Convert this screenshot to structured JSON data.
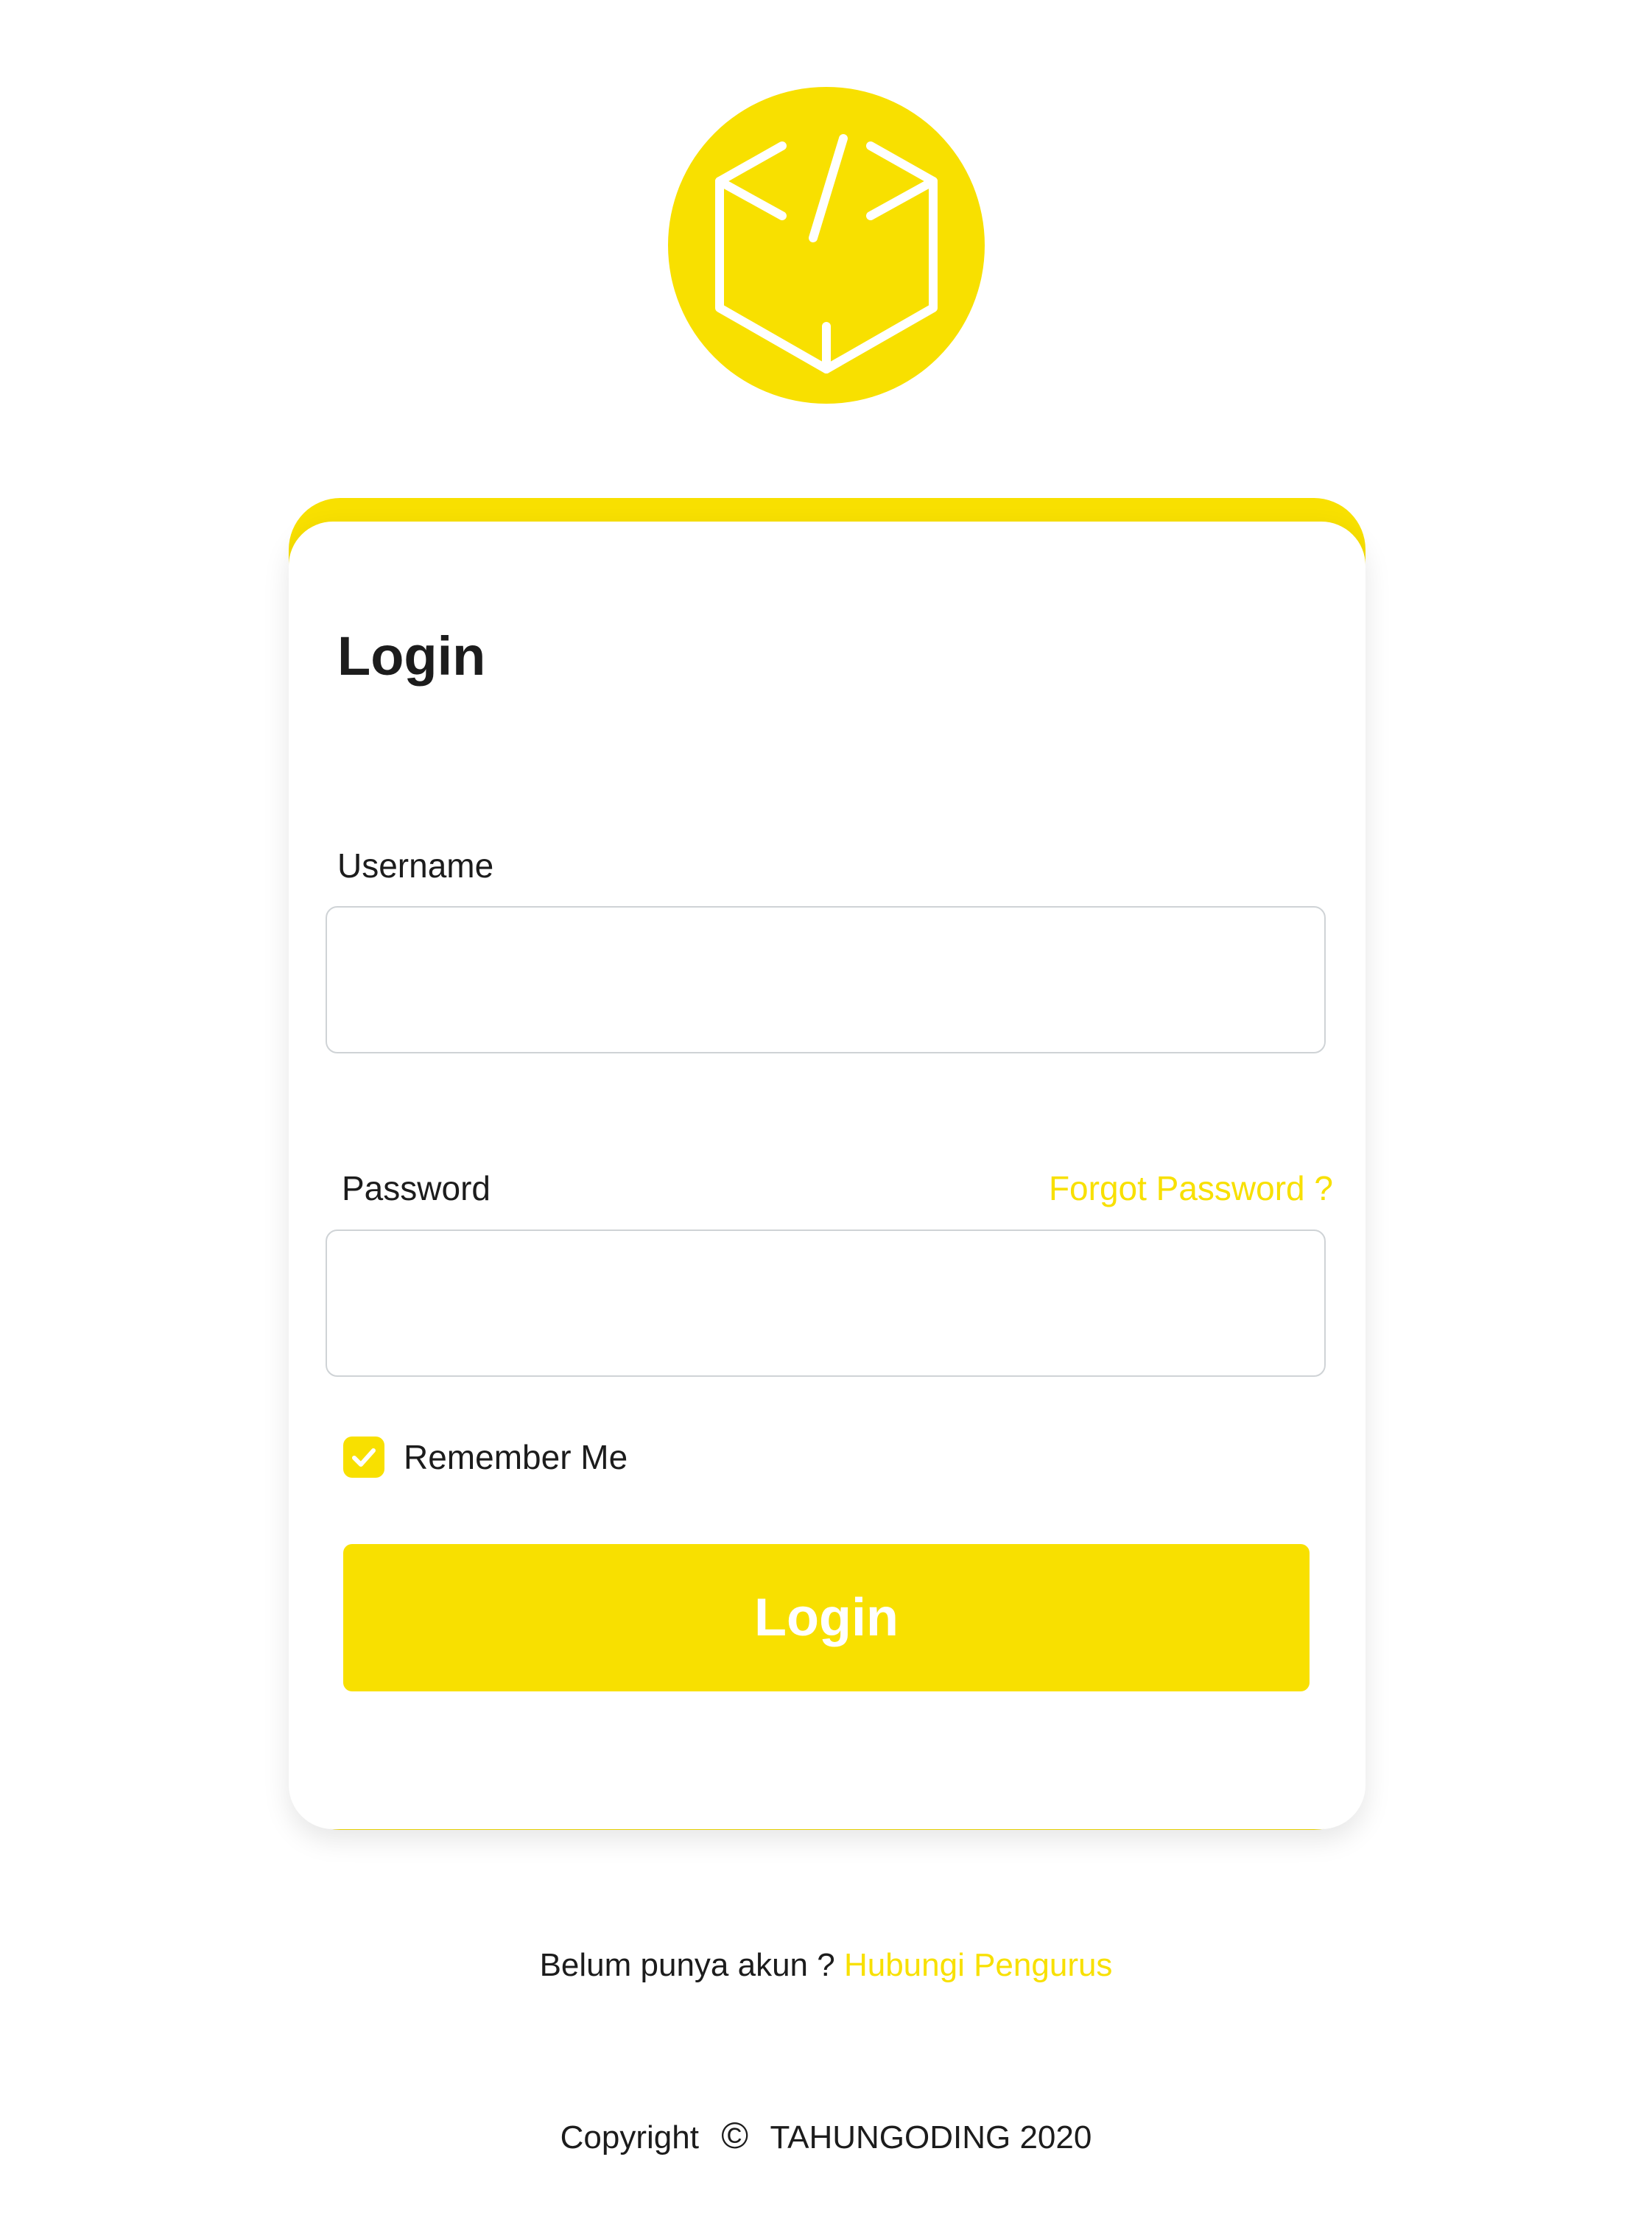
{
  "logo": {
    "icon": "code-box-icon",
    "color": "#f8e000"
  },
  "login_card": {
    "title": "Login",
    "accent_color": "#f8e000",
    "username": {
      "label": "Username",
      "value": "",
      "placeholder": ""
    },
    "password": {
      "label": "Password",
      "value": "",
      "placeholder": "",
      "forgot_link": "Forgot Password ?"
    },
    "remember_me": {
      "label": "Remember Me",
      "checked": true
    },
    "submit_label": "Login"
  },
  "signup": {
    "text": "Belum punya akun ?",
    "link": "Hubungi Pengurus"
  },
  "footer": {
    "copyright_prefix": "Copyright",
    "copyright_symbol": "©",
    "copyright_text": "TAHUNGODING 2020"
  }
}
